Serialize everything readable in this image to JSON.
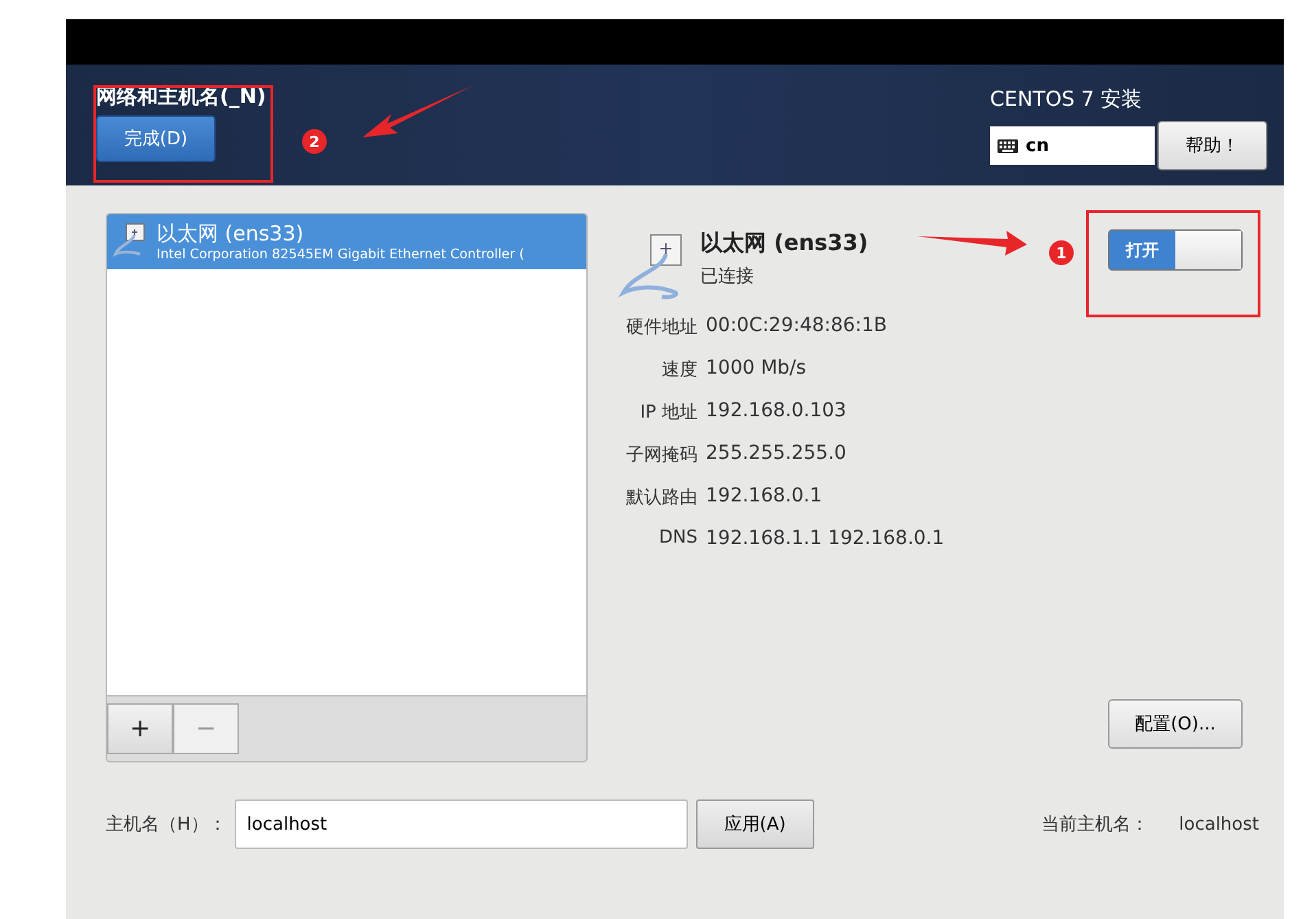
{
  "window": {
    "title": "网络和主机名(_N)",
    "product": "CENTOS 7 安装"
  },
  "done_button": "完成(D)",
  "keyboard_layout": "cn",
  "help_button": "帮助！",
  "connections": [
    {
      "name": "以太网 (ens33)",
      "description": "Intel Corporation 82545EM Gigabit Ethernet Controller (",
      "selected": true
    }
  ],
  "list_buttons": [
    {
      "label": "+",
      "disabled": false
    },
    {
      "label": "−",
      "disabled": true
    }
  ],
  "device": {
    "name": "以太网 (ens33)",
    "status": "已连接",
    "switch": {
      "label": "打开",
      "on": true
    },
    "details": [
      {
        "label": "硬件地址",
        "value": "00:0C:29:48:86:1B"
      },
      {
        "label": "速度",
        "value": "1000 Mb/s"
      },
      {
        "label": "IP 地址",
        "value": "192.168.0.103"
      },
      {
        "label": "子网掩码",
        "value": "255.255.255.0"
      },
      {
        "label": "默认路由",
        "value": "192.168.0.1"
      },
      {
        "label": "DNS",
        "value": "192.168.1.1 192.168.0.1"
      }
    ],
    "configure_button": "配置(O)..."
  },
  "hostname": {
    "label": "主机名（H）：",
    "value": "localhost",
    "apply_button": "应用(A)",
    "current_label": "当前主机名：",
    "current_value": "localhost"
  },
  "annotations": [
    {
      "label": "2"
    },
    {
      "label": "1"
    }
  ]
}
